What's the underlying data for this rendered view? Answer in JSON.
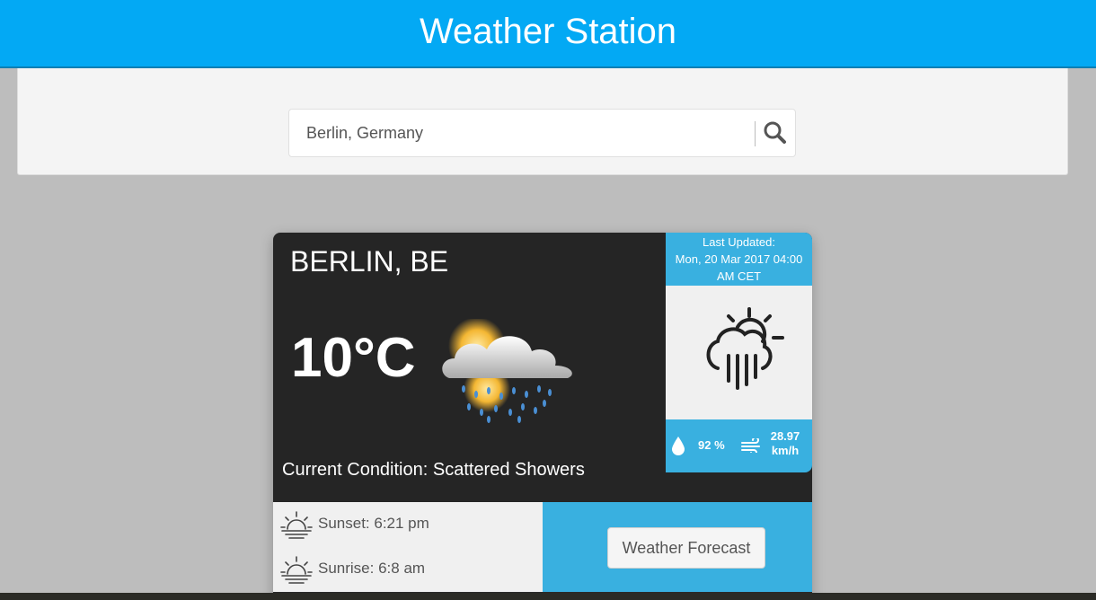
{
  "header": {
    "title": "Weather Station"
  },
  "search": {
    "value": "Berlin, Germany"
  },
  "card": {
    "city": "BERLIN, BE",
    "temperature": "10°C",
    "condition": "Current Condition: Scattered Showers",
    "condition_icon": "sun-cloud-rain-icon",
    "last_updated_label": "Last Updated:",
    "last_updated_line1": "Mon, 20 Mar 2017 04:00",
    "last_updated_line2": "AM CET",
    "weather_icon": "cloud-sun-rain-icon",
    "humidity": "92 %",
    "wind_value": "28.97",
    "wind_unit": "km/h",
    "sunset": "Sunset: 6:21 pm",
    "sunrise": "Sunrise: 6:8 am",
    "forecast_button": "Weather Forecast"
  },
  "colors": {
    "header": "#03a9f4",
    "accent": "#39b0e0",
    "card": "#252525",
    "background": "#bdbdbd"
  }
}
